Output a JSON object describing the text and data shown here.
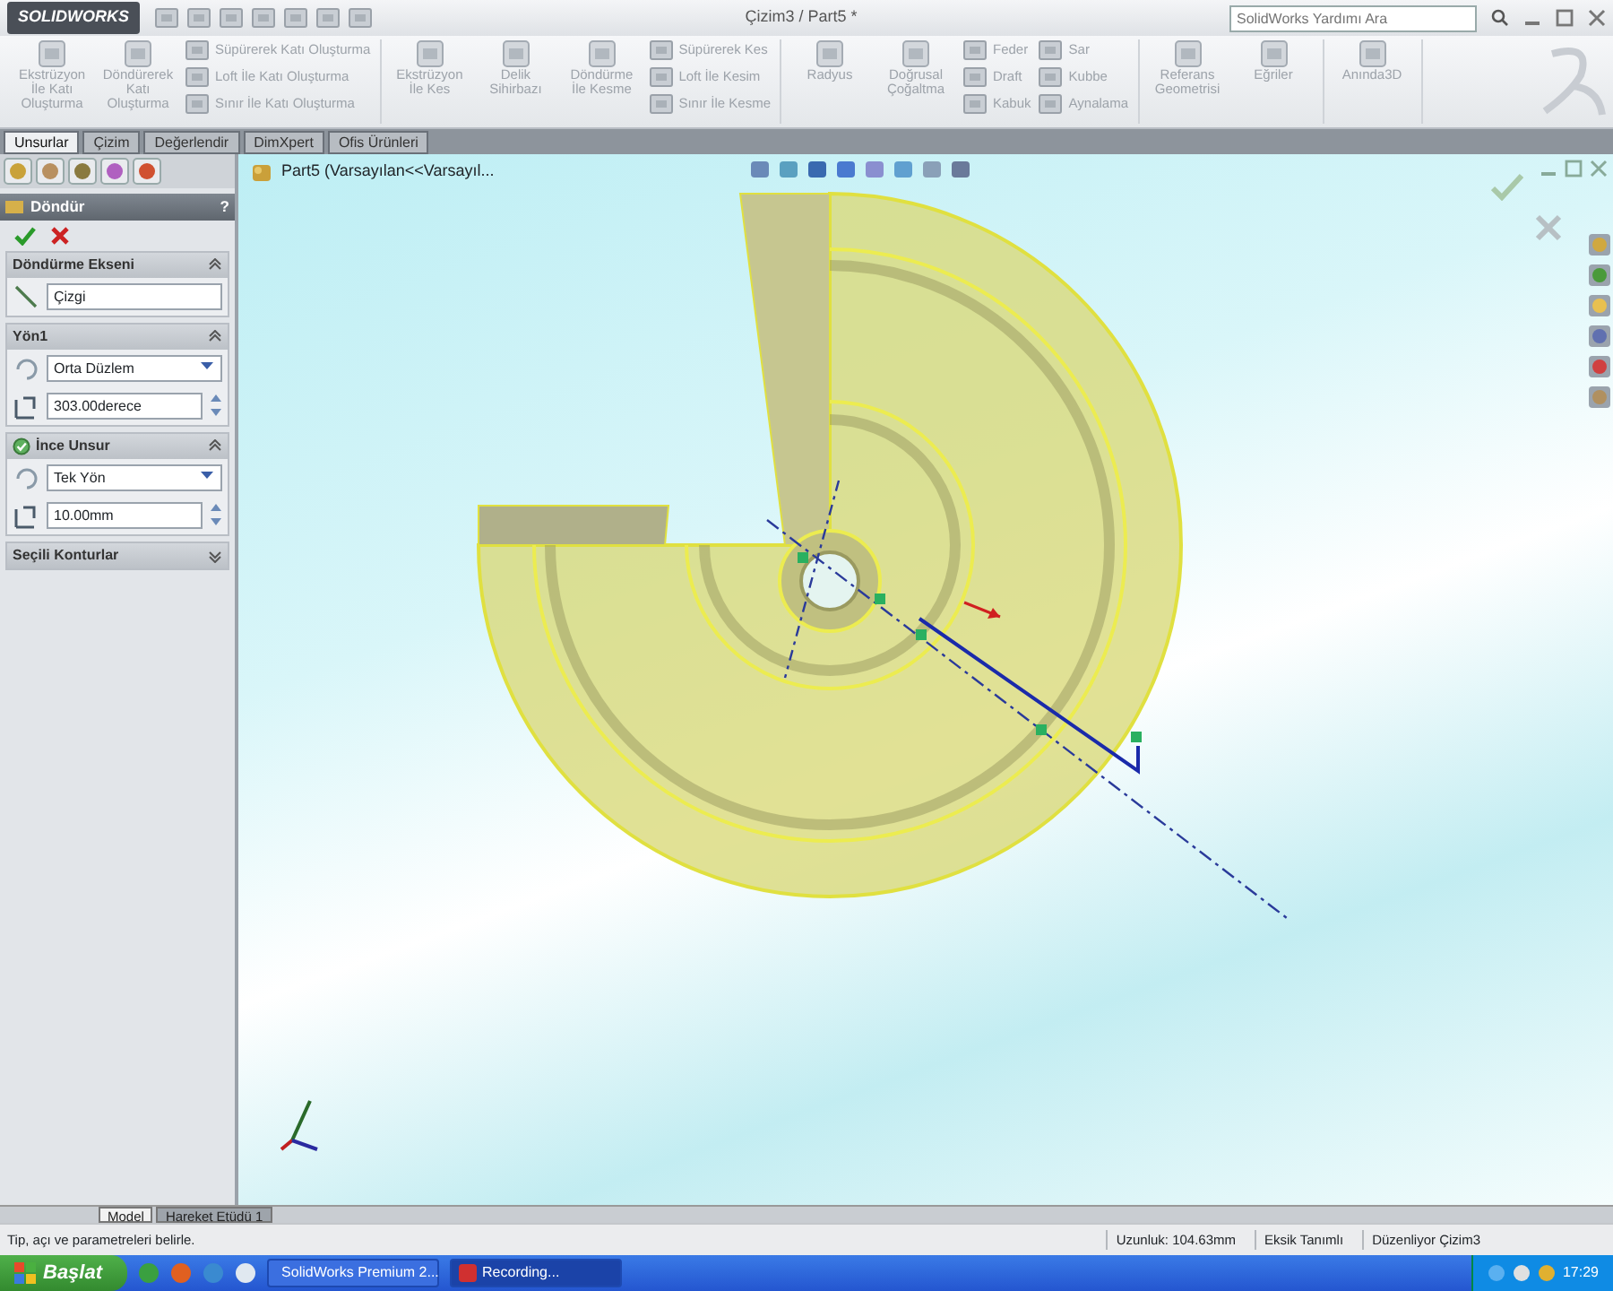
{
  "title_bar": {
    "logo": "SOLIDWORKS",
    "document": "Çizim3 / Part5 *",
    "search": {
      "placeholder": "SolidWorks Yardımı Ara"
    }
  },
  "ribbon": {
    "groups": [
      {
        "items": [
          {
            "kind": "large",
            "label": "Ekstrüzyon İle Katı Oluşturma",
            "disabled": true
          },
          {
            "kind": "large",
            "label": "Döndürerek Katı Oluşturma",
            "disabled": true
          },
          {
            "kind": "stack",
            "labels": [
              "Süpürerek Katı Oluşturma",
              "Loft İle Katı Oluşturma",
              "Sınır İle Katı Oluşturma"
            ],
            "disabled": true
          }
        ]
      },
      {
        "items": [
          {
            "kind": "large",
            "label": "Ekstrüzyon İle Kes",
            "disabled": true
          },
          {
            "kind": "large",
            "label": "Delik Sihirbazı",
            "disabled": true
          },
          {
            "kind": "large",
            "label": "Döndürme İle Kesme",
            "disabled": true
          },
          {
            "kind": "stack",
            "labels": [
              "Süpürerek Kes",
              "Loft İle Kesim",
              "Sınır İle Kesme"
            ],
            "disabled": true
          }
        ]
      },
      {
        "items": [
          {
            "kind": "large",
            "label": "Radyus",
            "disabled": true
          },
          {
            "kind": "large",
            "label": "Doğrusal Çoğaltma",
            "disabled": true
          },
          {
            "kind": "stack",
            "labels": [
              "Feder",
              "Draft",
              "Kabuk"
            ],
            "disabled": true
          },
          {
            "kind": "stack",
            "labels": [
              "Sar",
              "Kubbe",
              "Aynalama"
            ],
            "disabled": true
          }
        ]
      },
      {
        "items": [
          {
            "kind": "large",
            "label": "Referans Geometrisi",
            "disabled": true
          },
          {
            "kind": "large",
            "label": "Eğriler",
            "disabled": true
          }
        ]
      },
      {
        "items": [
          {
            "kind": "large",
            "label": "Anında3D",
            "disabled": true
          }
        ]
      }
    ]
  },
  "command_tabs": [
    {
      "label": "Unsurlar",
      "selected": true
    },
    {
      "label": "Çizim",
      "selected": false
    },
    {
      "label": "Değerlendir",
      "selected": false
    },
    {
      "label": "DimXpert",
      "selected": false
    },
    {
      "label": "Ofis Ürünleri",
      "selected": false
    }
  ],
  "property_manager": {
    "title": "Döndür",
    "help": "?",
    "sections": [
      {
        "title": "Döndürme Ekseni",
        "expanded": true,
        "rows": [
          {
            "kind": "field",
            "value": "Çizgi"
          }
        ]
      },
      {
        "title": "Yön1",
        "expanded": true,
        "rows": [
          {
            "kind": "select",
            "value": "Orta Düzlem"
          },
          {
            "kind": "spin",
            "value": "303.00derece"
          }
        ]
      },
      {
        "title": "İnce Unsur",
        "checked": true,
        "expanded": true,
        "rows": [
          {
            "kind": "select",
            "value": "Tek Yön"
          },
          {
            "kind": "spin",
            "value": "10.00mm"
          }
        ]
      },
      {
        "title": "Seçili Konturlar",
        "expanded": false
      }
    ]
  },
  "tree": {
    "label": "Part5 (Varsayılan<<Varsayıl..."
  },
  "bottom_tabs": [
    {
      "label": "Model",
      "selected": true
    },
    {
      "label": "Hareket Etüdü 1",
      "selected": false
    }
  ],
  "status_bar": {
    "message": "Tip, açı ve parametreleri belirle.",
    "fields": [
      "Uzunluk: 104.63mm",
      "Eksik Tanımlı",
      "Düzenliyor Çizim3"
    ]
  },
  "taskbar": {
    "start": "Başlat",
    "windows": [
      {
        "label": "SolidWorks Premium 2...",
        "selected": false
      },
      {
        "label": "Recording...",
        "selected": true
      }
    ],
    "clock": "17:29"
  }
}
